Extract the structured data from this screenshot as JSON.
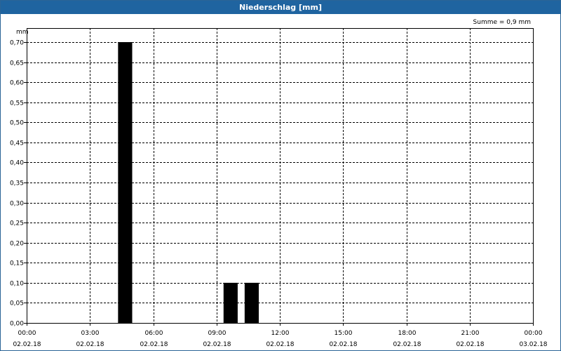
{
  "window": {
    "title": "Niederschlag [mm]"
  },
  "chart_data": {
    "type": "bar",
    "title": "Niederschlag [mm]",
    "ylabel": "mm",
    "annotation": "Summe = 0,9 mm",
    "ylim": [
      0,
      0.7
    ],
    "y_ticks": [
      "0,00",
      "0,05",
      "0,10",
      "0,15",
      "0,20",
      "0,25",
      "0,30",
      "0,35",
      "0,40",
      "0,45",
      "0,50",
      "0,55",
      "0,60",
      "0,65",
      "0,70"
    ],
    "x_ticks": [
      {
        "time": "00:00",
        "date": "02.02.18"
      },
      {
        "time": "03:00",
        "date": "02.02.18"
      },
      {
        "time": "06:00",
        "date": "02.02.18"
      },
      {
        "time": "09:00",
        "date": "02.02.18"
      },
      {
        "time": "12:00",
        "date": "02.02.18"
      },
      {
        "time": "15:00",
        "date": "02.02.18"
      },
      {
        "time": "18:00",
        "date": "02.02.18"
      },
      {
        "time": "21:00",
        "date": "02.02.18"
      },
      {
        "time": "00:00",
        "date": "03.02.18"
      }
    ],
    "x_range_hours": [
      0,
      24
    ],
    "bar_width_hours": 0.67,
    "bars": [
      {
        "start": "04:20",
        "value": 0.7
      },
      {
        "start": "09:20",
        "value": 0.1
      },
      {
        "start": "10:20",
        "value": 0.1
      }
    ],
    "grid": true,
    "bar_color": "#000000"
  }
}
